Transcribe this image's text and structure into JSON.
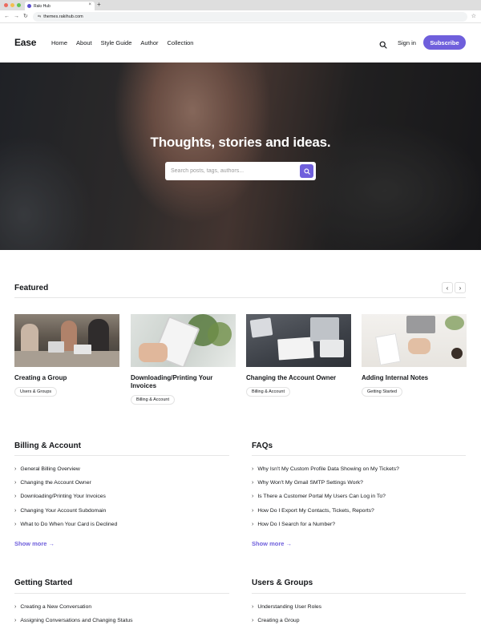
{
  "browser": {
    "tab_title": "Rakı Hub",
    "new_tab": "+",
    "url": "themes.rakihub.com"
  },
  "header": {
    "logo": "Ease",
    "nav": [
      "Home",
      "About",
      "Style Guide",
      "Author",
      "Collection"
    ],
    "signin": "Sign in",
    "subscribe": "Subscribe"
  },
  "hero": {
    "title": "Thoughts, stories and ideas.",
    "search_placeholder": "Search posts, tags, authors..."
  },
  "featured": {
    "title": "Featured",
    "prev": "‹",
    "next": "›",
    "cards": [
      {
        "title": "Creating a Group",
        "tag": "Users & Groups"
      },
      {
        "title": "Downloading/Printing Your Invoices",
        "tag": "Billing & Account"
      },
      {
        "title": "Changing the Account Owner",
        "tag": "Billing & Account"
      },
      {
        "title": "Adding Internal Notes",
        "tag": "Getting Started"
      }
    ]
  },
  "categories": {
    "billing": {
      "title": "Billing & Account",
      "items": [
        "General Billing Overview",
        "Changing the Account Owner",
        "Downloading/Printing Your Invoices",
        "Changing Your Account Subdomain",
        "What to Do When Your Card is Declined"
      ],
      "show_more": "Show more →"
    },
    "faqs": {
      "title": "FAQs",
      "items": [
        "Why Isn't My Custom Profile Data Showing on My Tickets?",
        "Why Won't My Gmail SMTP Settings Work?",
        "Is There a Customer Portal My Users Can Log in To?",
        "How Do I Export My Contacts, Tickets, Reports?",
        "How Do I Search for a Number?"
      ],
      "show_more": "Show more →"
    },
    "getting_started": {
      "title": "Getting Started",
      "items": [
        "Creating a New Conversation",
        "Assigning Conversations and Changing Status"
      ]
    },
    "users_groups": {
      "title": "Users & Groups",
      "items": [
        "Understanding User Roles",
        "Creating a Group"
      ]
    }
  },
  "colors": {
    "accent": "#6f5fdc",
    "text": "#15171a"
  }
}
